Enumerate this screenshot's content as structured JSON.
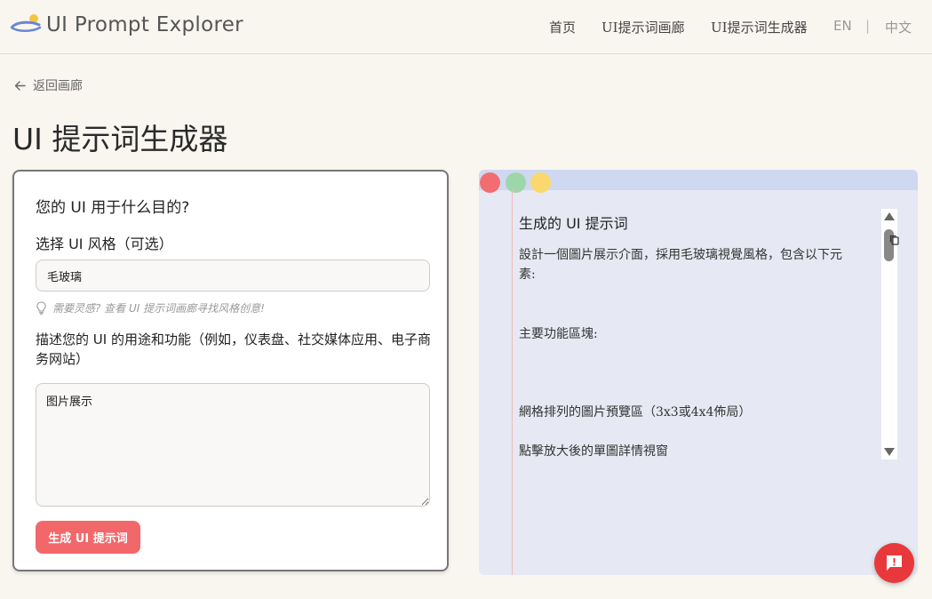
{
  "header": {
    "brand": "UI Prompt Explorer",
    "nav": [
      "首页",
      "UI提示词画廊",
      "UI提示词生成器"
    ],
    "lang": [
      "EN",
      "中文"
    ],
    "lang_separator": "|"
  },
  "back_link": "返回画廊",
  "page_title": "UI 提示词生成器",
  "form": {
    "purpose_question": "您的 UI 用于什么目的?",
    "style_label": "选择 UI 风格（可选）",
    "style_value": "毛玻璃",
    "hint": "需要灵感? 查看 UI 提示词画廊寻找风格创意!",
    "description_label": "描述您的 UI 的用途和功能（例如，仪表盘、社交媒体应用、电子商务网站）",
    "description_value": "图片展示",
    "generate_button": "生成 UI 提示词"
  },
  "output": {
    "title": "生成的 UI 提示词",
    "lines": [
      "設計一個圖片展示介面，採用毛玻璃視覺風格，包含以下元素:",
      "主要功能區塊:",
      "網格排列的圖片預覽區（3x3或4x4佈局）",
      "點擊放大後的單圖詳情視窗"
    ]
  },
  "icons": {
    "logo": "brand-logo-icon",
    "back": "arrow-left-icon",
    "hint": "lightbulb-icon",
    "copy": "copy-icon",
    "feedback": "feedback-icon"
  },
  "colors": {
    "accent": "#f2676a",
    "fab": "#e8383b",
    "background": "#f9f6f0",
    "output_bg": "#e6e9f3"
  }
}
